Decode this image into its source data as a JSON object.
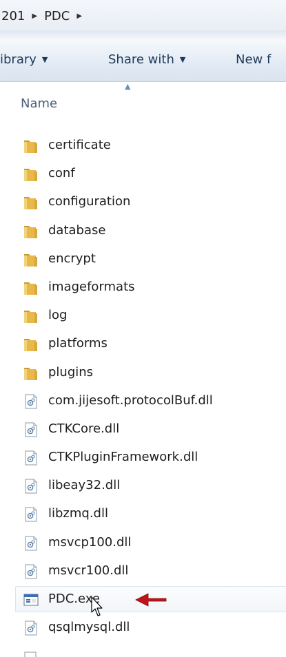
{
  "breadcrumb": {
    "segments": [
      "201",
      "PDC"
    ]
  },
  "toolbar": {
    "library_label": "ibrary",
    "share_label": "Share with",
    "new_label": "New f"
  },
  "column": {
    "name": "Name"
  },
  "files": [
    {
      "name": "certificate",
      "type": "folder"
    },
    {
      "name": "conf",
      "type": "folder"
    },
    {
      "name": "configuration",
      "type": "folder"
    },
    {
      "name": "database",
      "type": "folder"
    },
    {
      "name": "encrypt",
      "type": "folder"
    },
    {
      "name": "imageformats",
      "type": "folder"
    },
    {
      "name": "log",
      "type": "folder"
    },
    {
      "name": "platforms",
      "type": "folder"
    },
    {
      "name": "plugins",
      "type": "folder"
    },
    {
      "name": "com.jijesoft.protocolBuf.dll",
      "type": "dll"
    },
    {
      "name": "CTKCore.dll",
      "type": "dll"
    },
    {
      "name": "CTKPluginFramework.dll",
      "type": "dll"
    },
    {
      "name": "libeay32.dll",
      "type": "dll"
    },
    {
      "name": "libzmq.dll",
      "type": "dll"
    },
    {
      "name": "msvcp100.dll",
      "type": "dll"
    },
    {
      "name": "msvcr100.dll",
      "type": "dll"
    },
    {
      "name": "PDC.exe",
      "type": "exe"
    },
    {
      "name": "qsqlmysql.dll",
      "type": "dll"
    }
  ],
  "colors": {
    "arrow": "#c0141b",
    "toolbar_text": "#1e395b",
    "folder": "#e8b84a"
  },
  "icons": {
    "folder": "folder-icon",
    "dll": "dll-file-icon",
    "exe": "exe-file-icon",
    "pointer": "mouse-pointer-icon",
    "annotation": "red-arrow-icon"
  }
}
